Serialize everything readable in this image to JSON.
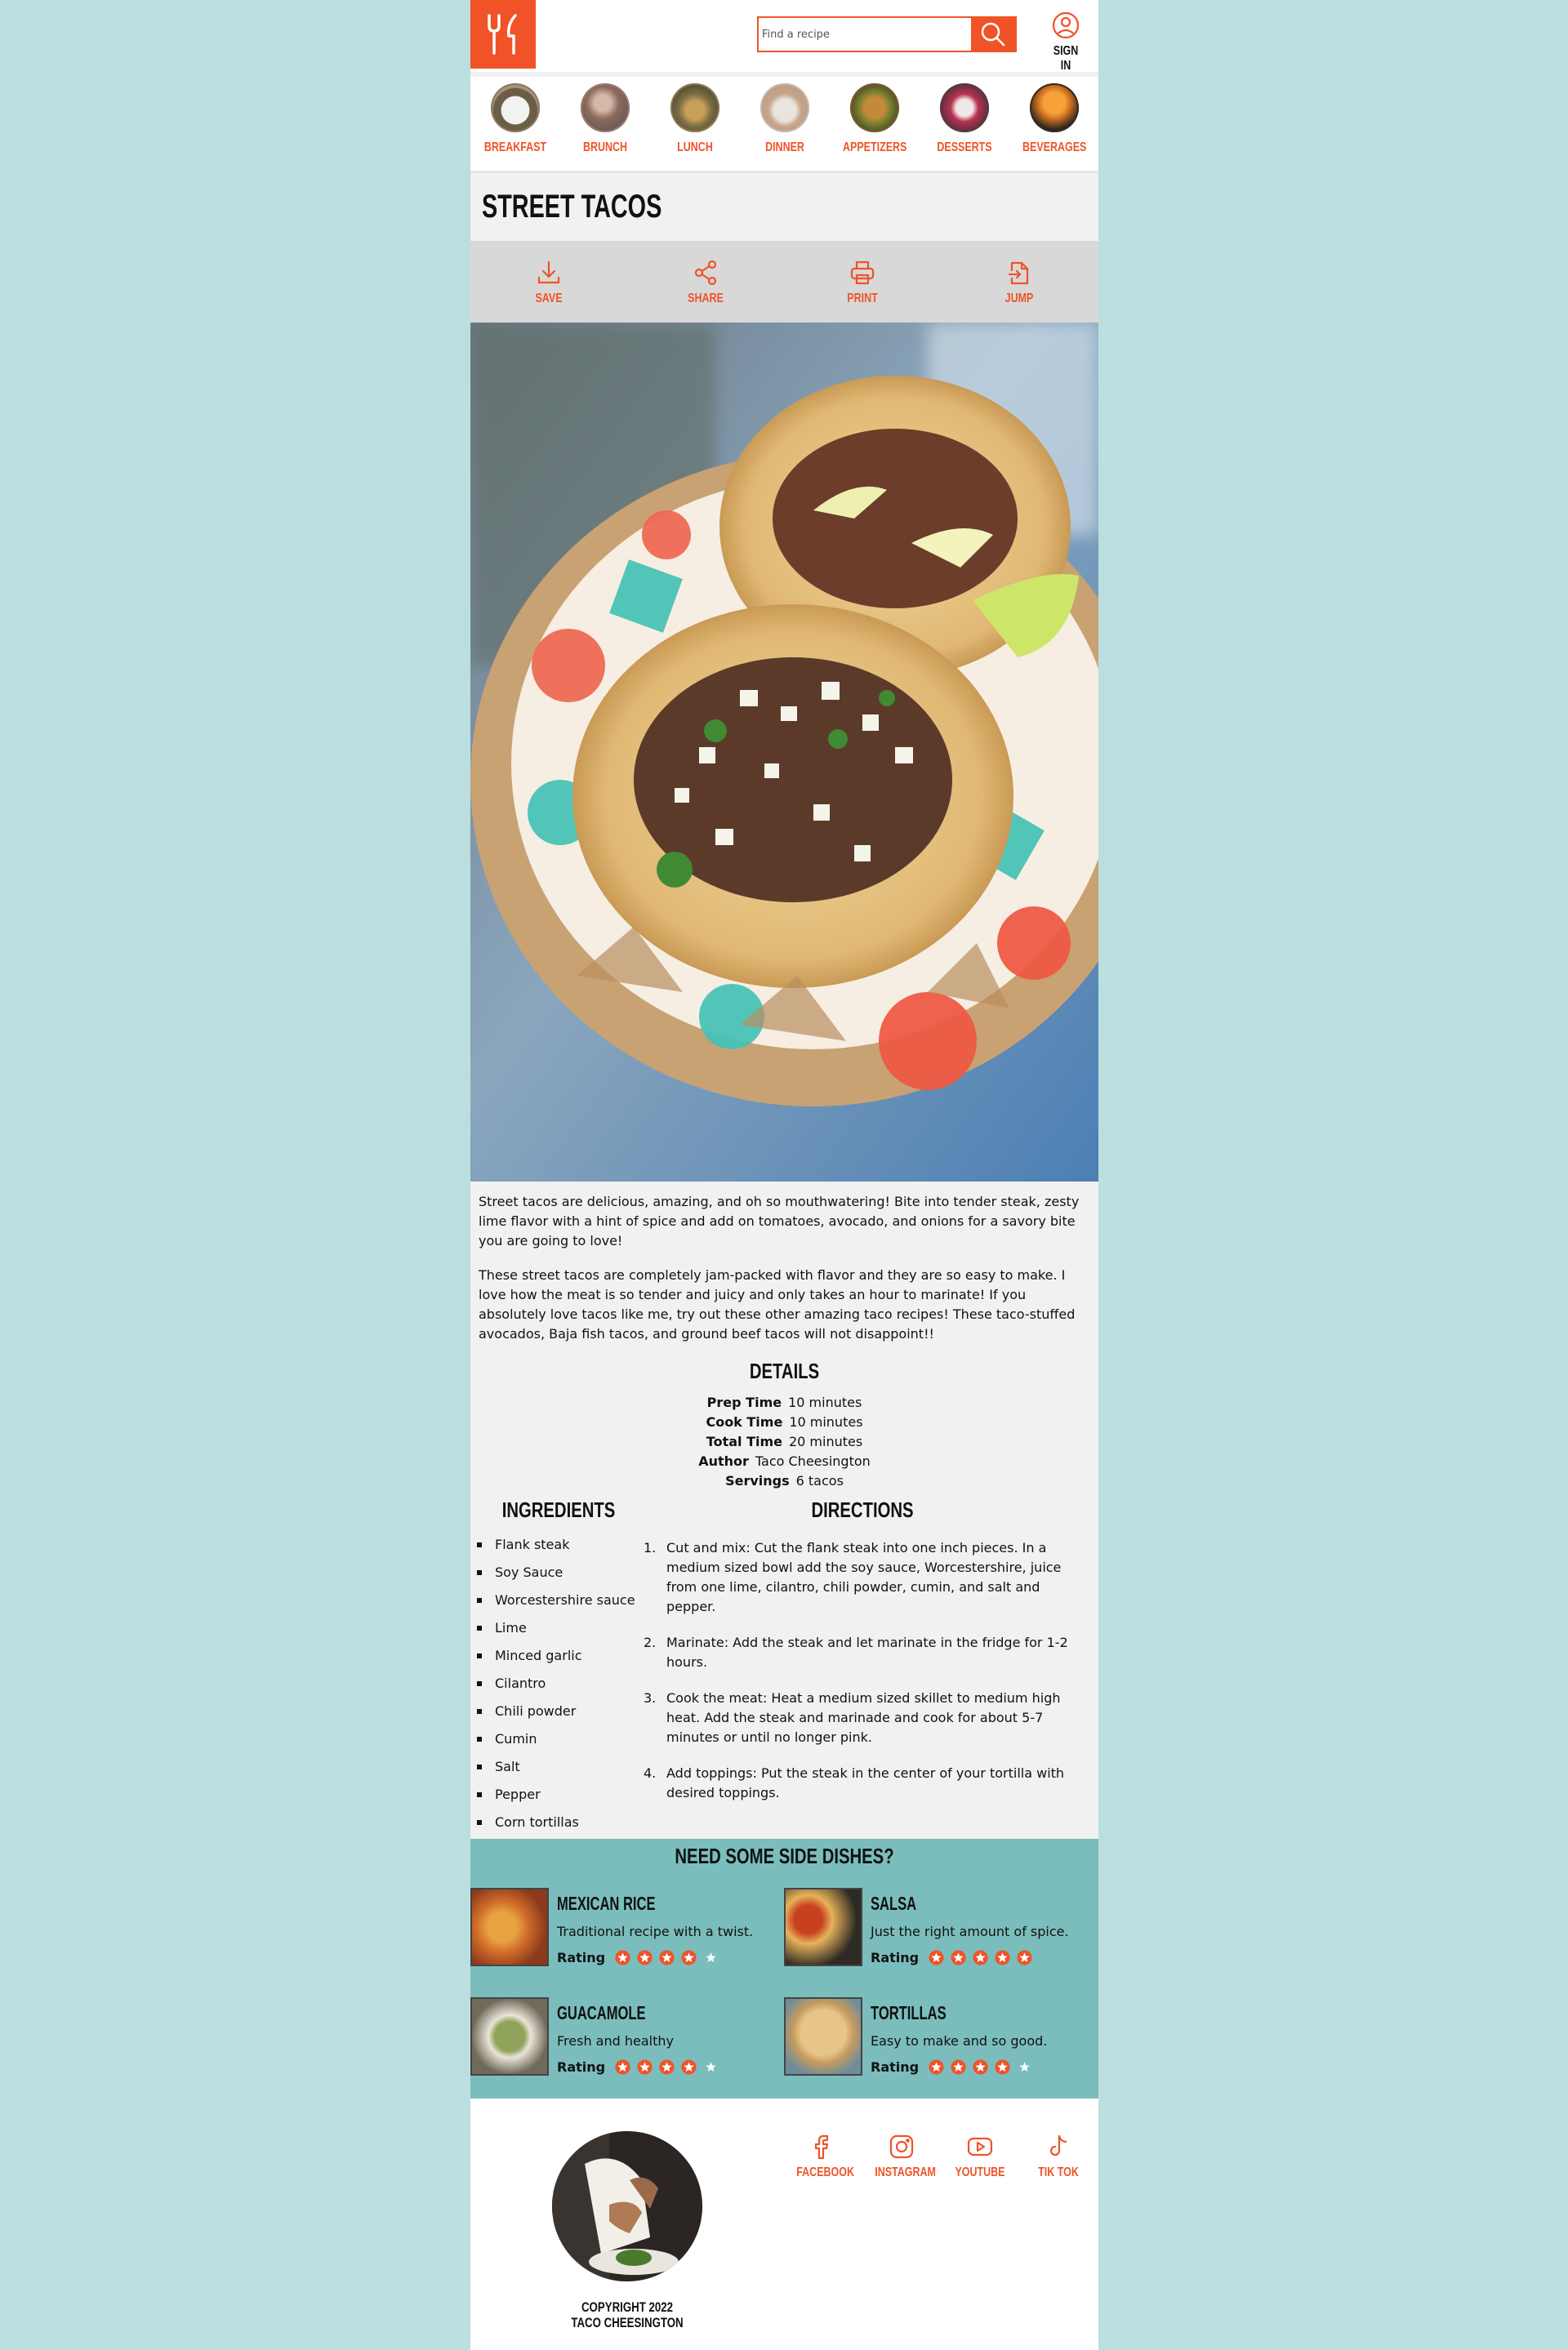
{
  "brand": {
    "accent": "#ef5327",
    "teal": "#7abdbc",
    "background": "#bbdfdf"
  },
  "header": {
    "logo_icon": "fork-knife-icon",
    "search": {
      "placeholder": "Find a recipe",
      "icon": "search-icon"
    },
    "signin": {
      "label": "SIGN IN",
      "icon": "user-circle-icon"
    }
  },
  "categories": [
    {
      "label": "BREAKFAST",
      "color": "#8c7a5c"
    },
    {
      "label": "BRUNCH",
      "color": "#9a7b6e"
    },
    {
      "label": "LUNCH",
      "color": "#8f7a4e"
    },
    {
      "label": "DINNER",
      "color": "#c9b8a8"
    },
    {
      "label": "APPETIZERS",
      "color": "#7a5a32"
    },
    {
      "label": "DESSERTS",
      "color": "#5a3a3e"
    },
    {
      "label": "BEVERAGES",
      "color": "#3a2a1e"
    }
  ],
  "recipe": {
    "title": "STREET TACOS",
    "actions": [
      {
        "label": "SAVE",
        "icon": "download-icon"
      },
      {
        "label": "SHARE",
        "icon": "share-icon"
      },
      {
        "label": "PRINT",
        "icon": "printer-icon"
      },
      {
        "label": "JUMP",
        "icon": "jump-icon"
      }
    ],
    "description": [
      "Street tacos are delicious, amazing, and oh so mouthwatering! Bite into tender steak, zesty lime flavor with a hint of spice and add on tomatoes, avocado, and onions for a savory bite you are going to love!",
      "These street tacos are completely jam-packed with flavor and they are so easy to make. I love how the meat is so tender and juicy and only takes an hour to marinate! If you absolutely love tacos like me, try out these other amazing taco recipes! These taco-stuffed avocados, Baja fish tacos, and ground beef tacos will not disappoint!!"
    ],
    "details_title": "DETAILS",
    "details": [
      {
        "label": "Prep Time",
        "value": "10 minutes"
      },
      {
        "label": "Cook Time",
        "value": "10 minutes"
      },
      {
        "label": "Total Time",
        "value": "20 minutes"
      },
      {
        "label": "Author",
        "value": "Taco Cheesington"
      },
      {
        "label": "Servings",
        "value": "6 tacos"
      }
    ],
    "ingredients_title": "INGREDIENTS",
    "ingredients": [
      "Flank steak",
      "Soy Sauce",
      "Worcestershire sauce",
      "Lime",
      "Minced garlic",
      "Cilantro",
      "Chili powder",
      "Cumin",
      "Salt",
      "Pepper",
      "Corn tortillas"
    ],
    "directions_title": "DIRECTIONS",
    "directions": [
      {
        "num": "1.",
        "text": "Cut and mix: Cut the flank steak into one inch pieces. In a medium sized bowl add the soy sauce, Worcestershire, juice from one lime, cilantro, chili powder, cumin, and salt and pepper."
      },
      {
        "num": "2.",
        "text": "Marinate: Add the steak and let marinate in the fridge for 1-2 hours."
      },
      {
        "num": "3.",
        "text": "Cook the meat: Heat a medium sized skillet to medium high heat. Add the steak and marinade and cook for about 5-7 minutes or until no longer pink."
      },
      {
        "num": "4.",
        "text": "Add toppings: Put the steak in the center of your tortilla with desired toppings."
      }
    ]
  },
  "sides": {
    "title": "NEED SOME SIDE DISHES?",
    "rating_label": "Rating",
    "items": [
      {
        "name": "MEXICAN RICE",
        "desc": "Traditional recipe with a twist.",
        "rating": 4,
        "max": 5
      },
      {
        "name": "SALSA",
        "desc": "Just the right amount of spice.",
        "rating": 5,
        "max": 5
      },
      {
        "name": "GUACAMOLE",
        "desc": "Fresh and healthy",
        "rating": 4,
        "max": 5
      },
      {
        "name": "TORTILLAS",
        "desc": "Easy to make and so good.",
        "rating": 4,
        "max": 5
      }
    ]
  },
  "footer": {
    "copyright_line1": "COPYRIGHT 2022",
    "copyright_line2": "TACO CHEESINGTON",
    "social": [
      {
        "label": "FACEBOOK",
        "icon": "facebook-icon"
      },
      {
        "label": "INSTAGRAM",
        "icon": "instagram-icon"
      },
      {
        "label": "YOUTUBE",
        "icon": "youtube-icon"
      },
      {
        "label": "TIK TOK",
        "icon": "tiktok-icon"
      }
    ]
  }
}
